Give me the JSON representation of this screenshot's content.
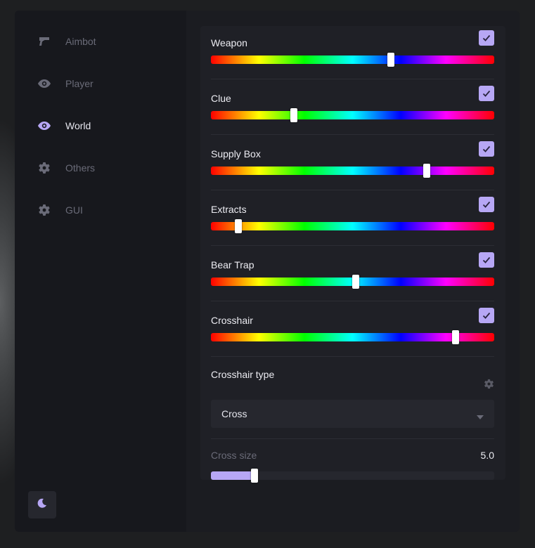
{
  "sidebar": {
    "items": [
      {
        "label": "Aimbot",
        "icon": "pistol-icon",
        "active": false
      },
      {
        "label": "Player",
        "icon": "eye-icon",
        "active": false
      },
      {
        "label": "World",
        "icon": "eye-icon",
        "active": true
      },
      {
        "label": "Others",
        "icon": "gear-icon",
        "active": false
      },
      {
        "label": "GUI",
        "icon": "gear-icon",
        "active": false
      }
    ],
    "theme_toggle_icon": "moon-icon"
  },
  "colors": {
    "accent": "#b7a7f5",
    "inactive_text": "#6a6b78",
    "active_text": "#e6e6ee",
    "window_bg": "#1b1c21",
    "sidebar_bg": "#17181d",
    "panel_bg": "#1f2026"
  },
  "settings": [
    {
      "label": "Weapon",
      "checked": true,
      "hue_position": 0.635
    },
    {
      "label": "Clue",
      "checked": true,
      "hue_position": 0.293
    },
    {
      "label": "Supply Box",
      "checked": true,
      "hue_position": 0.762
    },
    {
      "label": "Extracts",
      "checked": true,
      "hue_position": 0.097
    },
    {
      "label": "Bear Trap",
      "checked": true,
      "hue_position": 0.511
    },
    {
      "label": "Crosshair",
      "checked": true,
      "hue_position": 0.864
    }
  ],
  "crosshair_type": {
    "label": "Crosshair type",
    "selected": "Cross"
  },
  "cross_size": {
    "label": "Cross size",
    "value": "5.0",
    "fraction": 0.154
  }
}
